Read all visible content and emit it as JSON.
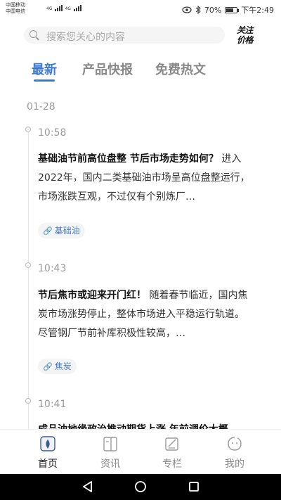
{
  "status_bar": {
    "carrier1": "中国移动",
    "carrier2": "中国电信",
    "net1": "4G",
    "net2": "4G",
    "battery": "70%",
    "battery_level": 0.7,
    "time": "下午2:49"
  },
  "search": {
    "placeholder": "搜索您关心的内容"
  },
  "logo": {
    "line1": "关注",
    "line2": "价格"
  },
  "tabs": [
    {
      "label": "最新",
      "active": true
    },
    {
      "label": "产品快报",
      "active": false
    },
    {
      "label": "免费热文",
      "active": false
    }
  ],
  "feed": {
    "date": "01-28",
    "items": [
      {
        "time": "10:58",
        "title": "基础油节前高位盘整 节后市场走势如何？",
        "summary": "进入2022年，国内二类基础油市场呈高位盘整运行，市场涨跌互观，不过仅有个别炼厂…",
        "tag": "基础油"
      },
      {
        "time": "10:43",
        "title": "节后焦市或迎来开门红！",
        "summary": "随着春节临近，国内焦炭市场涨势停止，整体市场进入平稳运行轨道。尽管钢厂节前补库积极性较高，…",
        "tag": "焦炭"
      },
      {
        "time": "10:41",
        "title": "成品油地缘政治推动期货上涨 年前调价大概"
      }
    ]
  },
  "bottom_nav": [
    {
      "label": "首页",
      "icon": "home-icon",
      "active": true
    },
    {
      "label": "资讯",
      "icon": "news-icon",
      "active": false
    },
    {
      "label": "专栏",
      "icon": "column-icon",
      "active": false
    },
    {
      "label": "我的",
      "icon": "profile-icon",
      "active": false
    }
  ],
  "colors": {
    "accent": "#3d7bd2",
    "tag_text": "#4a7bc8",
    "muted": "#999999"
  }
}
